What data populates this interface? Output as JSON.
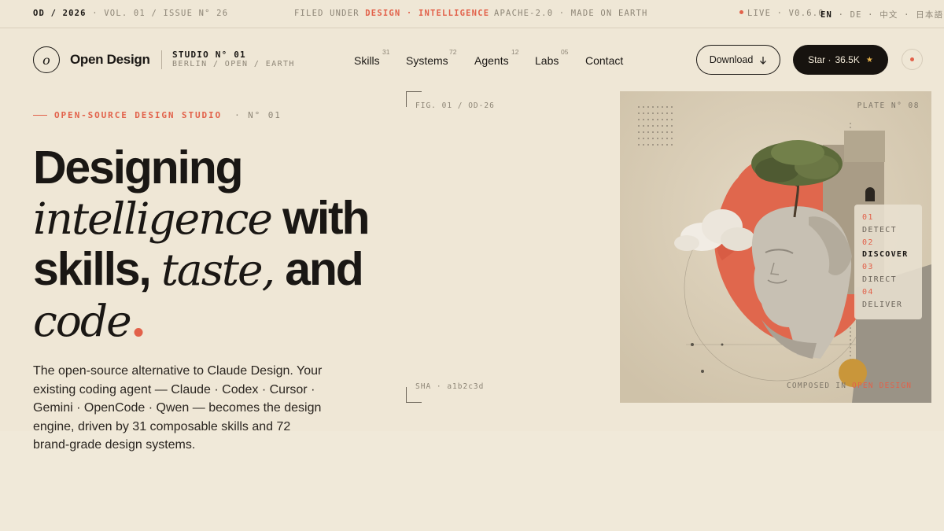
{
  "topbar": {
    "issue_code": "OD / 2026",
    "issue_meta": "· VOL. 01 / ISSUE N° 26",
    "filed_prefix": "FILED UNDER",
    "filed_topic": "DESIGN · INTELLIGENCE",
    "license": "APACHE-2.0 · MADE ON EARTH",
    "live": "LIVE · V0.6.0",
    "lang_active": "EN",
    "lang_others": "· DE · 中文 · 日本語"
  },
  "header": {
    "logo_glyph": "o",
    "logo_text": "Open Design",
    "studio_title": "STUDIO N° 01",
    "studio_sub": "BERLIN / OPEN / EARTH",
    "nav": [
      {
        "label": "Skills",
        "count": "31"
      },
      {
        "label": "Systems",
        "count": "72"
      },
      {
        "label": "Agents",
        "count": "12"
      },
      {
        "label": "Labs",
        "count": "05"
      },
      {
        "label": "Contact",
        "count": ""
      }
    ],
    "download_label": "Download",
    "download_icon": "arrow-down-icon",
    "star_label": "Star ·",
    "star_count": "36.5K",
    "star_icon": "★"
  },
  "hero": {
    "kicker_label": "OPEN-SOURCE DESIGN STUDIO",
    "kicker_num": "· N° 01",
    "headline": {
      "w1": "Designing",
      "w2": "intelligence",
      "w3": "with",
      "w4": "skills,",
      "w5": "taste,",
      "w6": "and",
      "w7": "code",
      "dot": "."
    },
    "lede": "The open-source alternative to Claude Design. Your existing coding agent — Claude · Codex · Cursor · Gemini · OpenCode · Qwen — becomes the design engine, driven by 31 composable skills and 72 brand-grade design systems."
  },
  "figure": {
    "fig_label": "FIG. 01 / OD-26",
    "sha_label": "SHA · a1b2c3d",
    "plate_label": "PLATE N° 08",
    "credit_prefix": "COMPOSED IN",
    "credit_accent": "OPEN DESIGN",
    "steps": [
      {
        "num": "01",
        "label": "DETECT",
        "active": false
      },
      {
        "num": "02",
        "label": "DISCOVER",
        "active": true
      },
      {
        "num": "03",
        "label": "DIRECT",
        "active": false
      },
      {
        "num": "04",
        "label": "DELIVER",
        "active": false
      }
    ]
  },
  "colors": {
    "background": "#efe7d6",
    "ink": "#1a1714",
    "accent": "#e2614a",
    "muted": "#8d8576",
    "star": "#e8b44c"
  }
}
